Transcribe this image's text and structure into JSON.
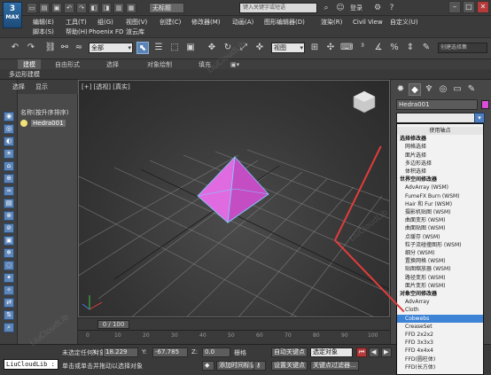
{
  "titlebar": {
    "logo": "3",
    "logo_sub": "MAX",
    "doc_title": "无标题",
    "search_placeholder": "键入关键字或短语",
    "login": "登录"
  },
  "menu": {
    "row1": [
      "编辑(E)",
      "工具(T)",
      "组(G)",
      "视图(V)",
      "创建(C)",
      "修改器(M)",
      "动画(A)",
      "图形编辑器(D)",
      "渲染(R)",
      "Civil View",
      "自定义(U)"
    ],
    "row2": [
      "脚本(S)",
      "帮助(H)",
      "Phoenix FD",
      "渲云库"
    ]
  },
  "toolbar": {
    "filter": "全部",
    "ref_coord": "视图",
    "selset": "创建选择集"
  },
  "ribbon": {
    "tabs": [
      "建模",
      "自由形式",
      "选择",
      "对象绘制",
      "填充"
    ],
    "sub_label": "多边形建模"
  },
  "explorer": {
    "tabs": [
      "选择",
      "显示"
    ],
    "column_header": "名称(按升序排序)",
    "object": "Hedra001"
  },
  "viewport": {
    "label": "[+] [透视] [真实]"
  },
  "timeline": {
    "slider": "0 / 100",
    "ticks": [
      "0",
      "10",
      "20",
      "30",
      "40",
      "50",
      "60",
      "70",
      "80",
      "90",
      "100"
    ]
  },
  "status": {
    "script_text": "LiuCloudLib :",
    "status_line1": "未选定任何对象",
    "status_line2": "单击或单击并拖动以选择对象",
    "x_label": "X:",
    "x_value": "18.229",
    "y_label": "Y:",
    "y_value": "-67.785",
    "z_label": "Z:",
    "z_value": "0.0",
    "grid": "栅格",
    "add_time_tag": "添加时间标记",
    "autokey": "自动关键点",
    "setkey": "设置关键点",
    "sel_object": "选定对象",
    "key_filters": "关键点过滤器..."
  },
  "command_panel": {
    "object_name": "Hedra001",
    "swatch_color": "#d94fd9"
  },
  "modifier_list": {
    "items": [
      {
        "text": "使用轴点",
        "kind": "first"
      },
      {
        "text": "选择修改器",
        "kind": "group"
      },
      {
        "text": "网格选择",
        "kind": "item"
      },
      {
        "text": "面片选择",
        "kind": "item"
      },
      {
        "text": "多边形选择",
        "kind": "item"
      },
      {
        "text": "体积选择",
        "kind": "item"
      },
      {
        "text": "世界空间修改器",
        "kind": "group"
      },
      {
        "text": "AdvArray (WSM)",
        "kind": "item"
      },
      {
        "text": "FumeFX Burn (WSM)",
        "kind": "item"
      },
      {
        "text": "Hair 和 Fur (WSM)",
        "kind": "item"
      },
      {
        "text": "摄影机贴图 (WSM)",
        "kind": "item"
      },
      {
        "text": "曲面变形 (WSM)",
        "kind": "item"
      },
      {
        "text": "曲面贴图 (WSM)",
        "kind": "item"
      },
      {
        "text": "点缓存 (WSM)",
        "kind": "item"
      },
      {
        "text": "粒子流碰撞图形 (WSM)",
        "kind": "item"
      },
      {
        "text": "细分 (WSM)",
        "kind": "item"
      },
      {
        "text": "置换网格 (WSM)",
        "kind": "item"
      },
      {
        "text": "贴图缩放器 (WSM)",
        "kind": "item"
      },
      {
        "text": "路径变形 (WSM)",
        "kind": "item"
      },
      {
        "text": "面片变形 (WSM)",
        "kind": "item"
      },
      {
        "text": "对象空间修改器",
        "kind": "group"
      },
      {
        "text": "AdvArray",
        "kind": "item"
      },
      {
        "text": "Cloth",
        "kind": "item"
      },
      {
        "text": "Cobwebs",
        "kind": "sel"
      },
      {
        "text": "CreaseSet",
        "kind": "item"
      },
      {
        "text": "FFD 2x2x2",
        "kind": "item"
      },
      {
        "text": "FFD 3x3x3",
        "kind": "item"
      },
      {
        "text": "FFD 4x4x4",
        "kind": "item"
      },
      {
        "text": "FFD(圆柱体)",
        "kind": "item"
      },
      {
        "text": "FFD(长方体)",
        "kind": "item"
      }
    ]
  },
  "colors": {
    "accent": "#3d83d6",
    "pyramid": "#d855d4",
    "annotation": "#e23c3c"
  },
  "watermark": "LiuCloudLib"
}
